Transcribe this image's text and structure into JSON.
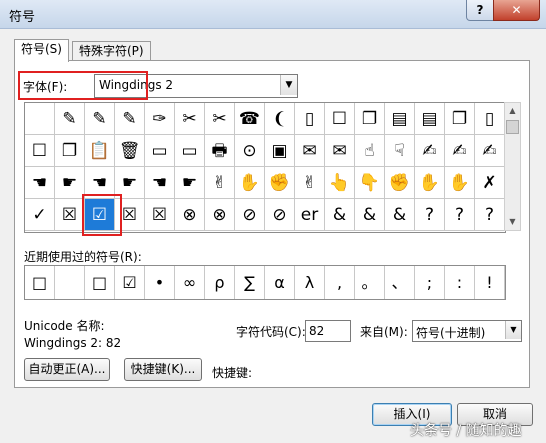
{
  "window": {
    "title": "符号",
    "help_glyph": "?",
    "close_glyph": "✕"
  },
  "tabs": [
    "符号(S)",
    "特殊字符(P)"
  ],
  "font": {
    "label": "字体(F):",
    "value": "Wingdings 2"
  },
  "symbol_grid": {
    "rows": [
      [
        "",
        "✎",
        "✎",
        "✎",
        "✑",
        "✂",
        "✂",
        "☎",
        "❨",
        "▯",
        "☐",
        "❐",
        "▤",
        "▤",
        "❐",
        "▯"
      ],
      [
        "☐",
        "❐",
        "📋",
        "🗑",
        "▭",
        "▭",
        "🖶",
        "⊙",
        "▣",
        "✉",
        "✉",
        "☝",
        "☟",
        "✍",
        "✍",
        "✍"
      ],
      [
        "☚",
        "☛",
        "☚",
        "☛",
        "☚",
        "☛",
        "✌",
        "✋",
        "✊",
        "✌",
        "👆",
        "👇",
        "✊",
        "✋",
        "✋",
        "✗"
      ],
      [
        "✓",
        "☒",
        "☑",
        "☒",
        "☒",
        "⊗",
        "⊗",
        "⊘",
        "⊘",
        "er",
        "&",
        "&",
        "&",
        "?",
        "?",
        "?"
      ]
    ],
    "selected": "☑"
  },
  "recent": {
    "label": "近期使用过的符号(R):",
    "symbols": [
      "□",
      "",
      "□",
      "☑",
      "•",
      "∞",
      "ρ",
      "∑",
      "α",
      "λ",
      ",",
      "。",
      "、",
      ";",
      ":",
      "!"
    ]
  },
  "unicode_name_label": "Unicode 名称:",
  "unicode_value": "Wingdings 2: 82",
  "char_code": {
    "label": "字符代码(C):",
    "value": "82"
  },
  "from": {
    "label": "来自(M):",
    "value": "符号(十进制)"
  },
  "buttons": {
    "autocorrect": "自动更正(A)...",
    "shortcut_key": "快捷键(K)...",
    "insert": "插入(I)",
    "cancel": "取消"
  },
  "shortcut_label": "快捷键:",
  "watermark": "头条号 / 随知的趣",
  "icons": {
    "dropdown": "▼",
    "scroll_up": "▲",
    "scroll_down": "▼"
  },
  "colors": {
    "highlight": "#e02020",
    "selection": "#1e7bd8"
  }
}
